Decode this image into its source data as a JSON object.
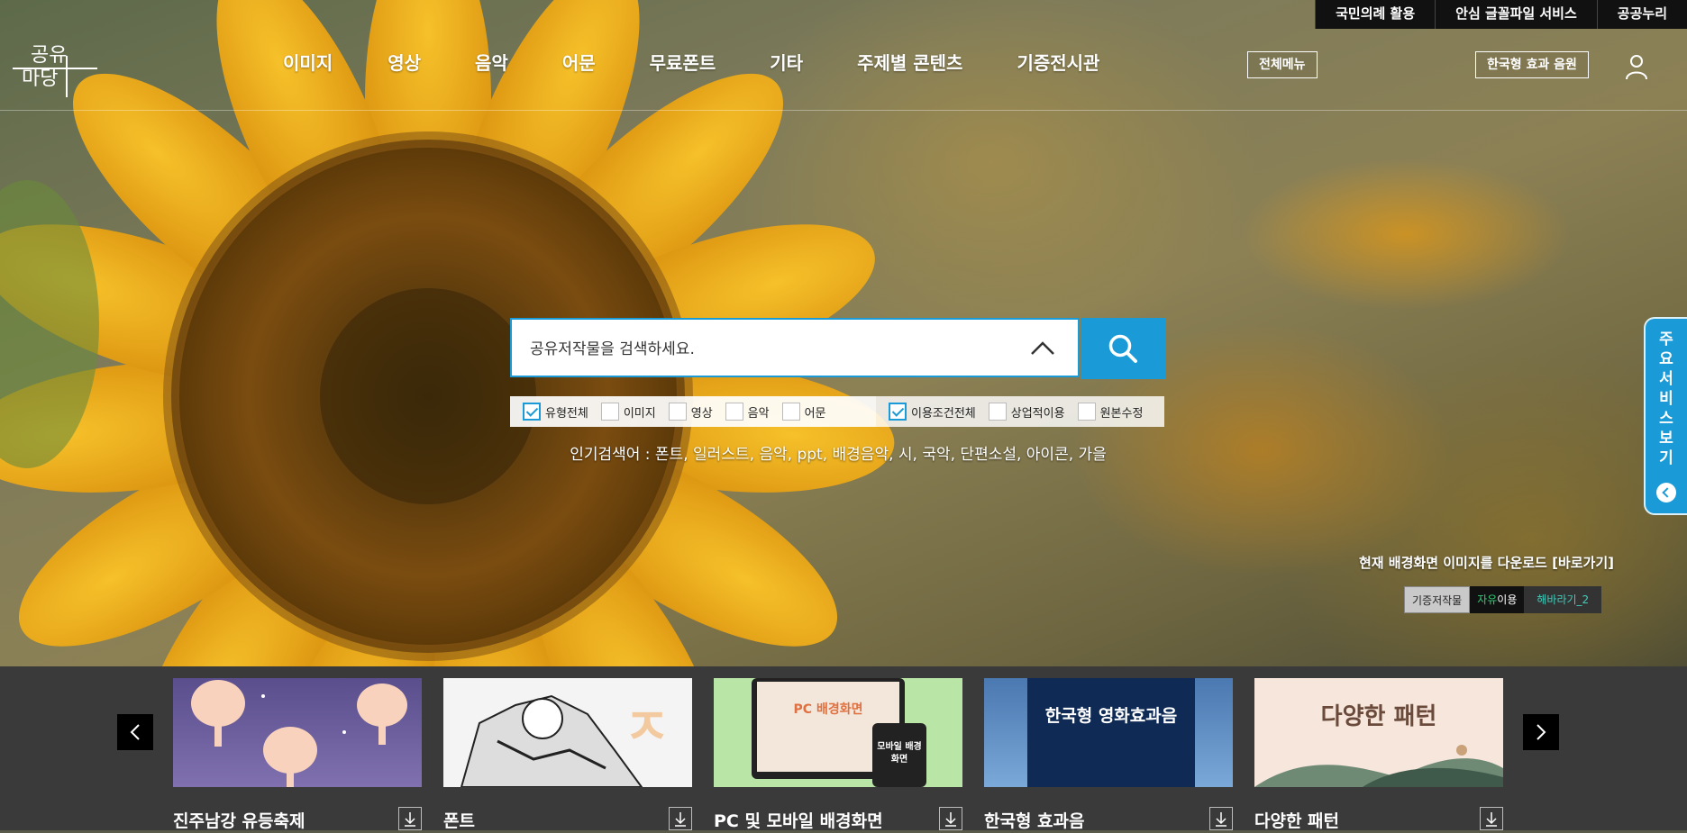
{
  "topbar": {
    "links": [
      "국민의례 활용",
      "안심 글꼴파일 서비스",
      "공공누리"
    ]
  },
  "logo": {
    "text": "공유마당"
  },
  "nav": {
    "items": [
      "이미지",
      "영상",
      "음악",
      "어문",
      "무료폰트",
      "기타",
      "주제별 콘텐츠",
      "기증전시관"
    ]
  },
  "header": {
    "all_menu": "전체메뉴",
    "sound_effects": "한국형 효과 음원"
  },
  "search": {
    "placeholder": "공유저작물을 검색하세요.",
    "types": [
      {
        "label": "유형전체",
        "checked": true
      },
      {
        "label": "이미지",
        "checked": false
      },
      {
        "label": "영상",
        "checked": false
      },
      {
        "label": "음악",
        "checked": false
      },
      {
        "label": "어문",
        "checked": false
      }
    ],
    "conditions": [
      {
        "label": "이용조건전체",
        "checked": true
      },
      {
        "label": "상업적이용",
        "checked": false
      },
      {
        "label": "원본수정",
        "checked": false
      }
    ],
    "popular": "인기검색어 : 폰트, 일러스트, 음악, ppt, 배경음악, 시, 국악, 단편소설, 아이콘, 가을"
  },
  "side_tab": {
    "label": "주요서비스보기"
  },
  "background": {
    "download_text": "현재 배경화면 이미지를 다운로드 [바로가기]",
    "license_a": "기증저작물",
    "license_b_accent": "자유",
    "license_b_rest": "이용",
    "image_name": "해바라기_2"
  },
  "carousel": {
    "cards": [
      {
        "title": "진주남강 유등축제"
      },
      {
        "title": "폰트",
        "thumb_text": "ㅈ"
      },
      {
        "title": "PC 및 모바일 배경화면",
        "thumb_text": "PC 배경화면",
        "thumb_text2": "모바일 배경화면"
      },
      {
        "title": "한국형 효과음",
        "thumb_text": "한국형 영화효과음"
      },
      {
        "title": "다양한 패턴",
        "thumb_text": "다양한 패턴"
      }
    ]
  },
  "colors": {
    "accent": "#1a9ad6",
    "topbar_bg": "#111111",
    "carousel_bg": "#3a3a3a"
  }
}
